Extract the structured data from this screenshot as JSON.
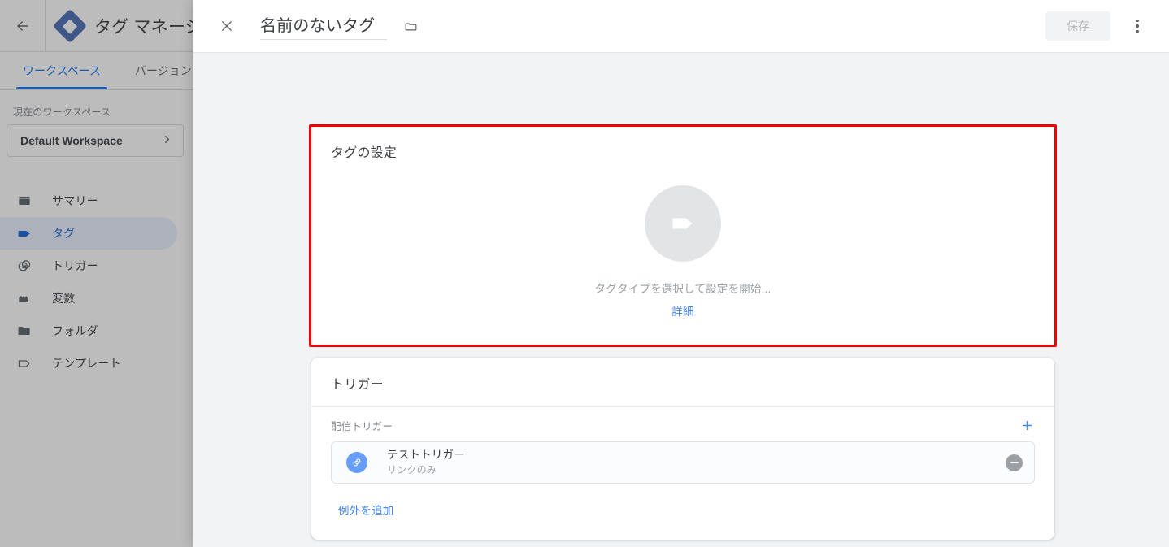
{
  "app": {
    "back_icon": "back-arrow-icon",
    "logo_icon": "gtm-logo-icon",
    "title": "タグ マネージャー",
    "tabs": [
      {
        "label": "ワークスペース",
        "active": true
      },
      {
        "label": "バージョン",
        "active": false
      }
    ],
    "sidebar": {
      "workspace_label": "現在のワークスペース",
      "workspace_name": "Default Workspace",
      "workspace_chevron": "chevron-right-icon",
      "items": [
        {
          "label": "サマリー",
          "icon": "summary-icon",
          "active": false
        },
        {
          "label": "タグ",
          "icon": "tag-icon",
          "active": true
        },
        {
          "label": "トリガー",
          "icon": "trigger-icon",
          "active": false
        },
        {
          "label": "変数",
          "icon": "variable-icon",
          "active": false
        },
        {
          "label": "フォルダ",
          "icon": "folder-icon",
          "active": false
        },
        {
          "label": "テンプレート",
          "icon": "template-icon",
          "active": false
        }
      ]
    }
  },
  "modal": {
    "close_icon": "close-icon",
    "tag_name": "名前のないタグ",
    "folder_icon": "folder-outline-icon",
    "save_label": "保存",
    "save_disabled": true,
    "kebab_icon": "more-vert-icon",
    "tag_config": {
      "title": "タグの設定",
      "placeholder_icon": "tag-placeholder-icon",
      "empty_text": "タグタイプを選択して設定を開始...",
      "details_link": "詳細",
      "highlight_color": "#f40000"
    },
    "triggers": {
      "title": "トリガー",
      "section_label": "配信トリガー",
      "add_icon": "plus-icon",
      "rows": [
        {
          "icon": "link-icon",
          "name": "テストトリガー",
          "subtitle": "リンクのみ",
          "remove_icon": "minus-circle-icon"
        }
      ],
      "exception_link": "例外を追加"
    }
  },
  "colors": {
    "accent_blue": "#1a73e8",
    "link_blue": "#4285f4",
    "active_nav_bg": "#e8f0fe",
    "modal_bg": "#f1f3f4",
    "highlight_red": "#f40000",
    "muted_text": "#9aa0a6"
  }
}
